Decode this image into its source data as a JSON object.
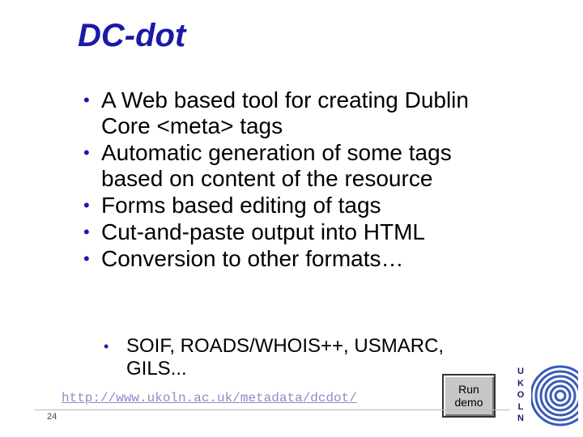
{
  "slide": {
    "title": "DC-dot",
    "bullets": [
      "A Web based tool for creating Dublin Core <meta> tags",
      "Automatic generation of some tags based on content of the resource",
      "Forms based editing of tags",
      "Cut-and-paste output into HTML",
      "Conversion to other formats…"
    ],
    "sub_bullets": [
      "SOIF, ROADS/WHOIS++, USMARC, GILS..."
    ],
    "url": "http://www.ukoln.ac.uk/metadata/dcdot/",
    "run_button": {
      "line1": "Run",
      "line2": "demo"
    },
    "page_number": "24",
    "logo_letters": [
      "U",
      "K",
      "O",
      "L",
      "N"
    ]
  },
  "colors": {
    "title": "#1a1aa8",
    "bullet": "#1a1aa8",
    "link": "#8c8cc8",
    "logo": "#1a1a6e"
  }
}
